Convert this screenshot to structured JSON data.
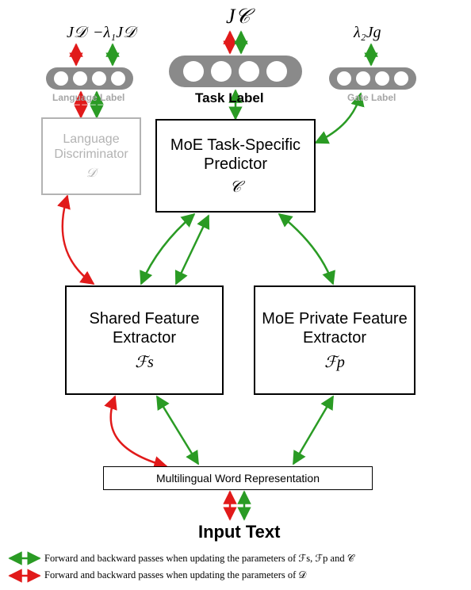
{
  "top": {
    "loss_jc": "J𝒞",
    "loss_jd": "J𝒟",
    "loss_neglambda1_jd": "−λ₁J𝒟",
    "loss_lambda2_jg": "λ₂Jg",
    "label_task": "Task Label",
    "label_language": "Language Label",
    "label_gate": "Gate Label"
  },
  "boxes": {
    "lang_disc_title": "Language Discriminator",
    "lang_disc_sym": "𝒟",
    "predictor_title": "MoE Task-Specific Predictor",
    "predictor_sym": "𝒞",
    "shared_title": "Shared Feature Extractor",
    "shared_sym": "ℱs",
    "private_title": "MoE Private Feature Extractor",
    "private_sym": "ℱp"
  },
  "wordrep": "Multilingual Word Representation",
  "input": "Input Text",
  "legend": {
    "green": "Forward and backward passes when updating the parameters of ℱs, ℱp and 𝒞",
    "red": "Forward and backward passes when updating the parameters of 𝒟"
  },
  "colors": {
    "green": "#2a9b24",
    "red": "#e11a1a",
    "capsule": "#8a8a8a",
    "boxgray": "#b3b3b3"
  },
  "icons": {
    "capsule": "capsule-shape",
    "arrow": "double-arrow"
  }
}
